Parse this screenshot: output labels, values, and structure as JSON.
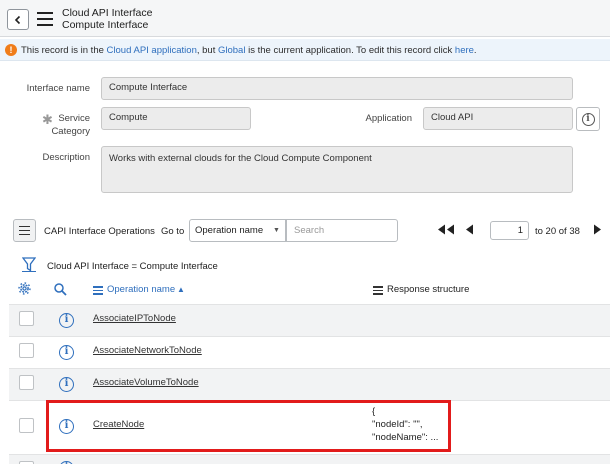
{
  "header": {
    "title_line1": "Cloud API Interface",
    "title_line2": "Compute Interface"
  },
  "banner": {
    "icon": "!",
    "text_1": "This record is in the ",
    "link_app": "Cloud API application",
    "text_2": ", but ",
    "link_global": "Global",
    "text_3": " is the current application. To edit this record click ",
    "link_here": "here",
    "text_4": "."
  },
  "form": {
    "interface_name_label": "Interface name",
    "interface_name_value": "Compute Interface",
    "required_mark": "✱",
    "service_category_label_1": "Service",
    "service_category_label_2": "Category",
    "service_category_value": "Compute",
    "application_label": "Application",
    "application_value": "Cloud API",
    "description_label": "Description",
    "description_value": "Works with external clouds for the Cloud Compute Component"
  },
  "list": {
    "title": "CAPI Interface Operations",
    "goto_label": "Go to",
    "goto_field": "Operation name",
    "search_placeholder": "Search",
    "page_value": "1",
    "page_range": "to 20 of 38",
    "filter_text": "Cloud API Interface = Compute Interface",
    "columns": {
      "operation_name": "Operation name",
      "response_structure": "Response structure",
      "sort_indicator": "▲"
    },
    "rows": [
      {
        "name": "AssociateIPToNode",
        "response": ""
      },
      {
        "name": "AssociateNetworkToNode",
        "response": ""
      },
      {
        "name": "AssociateVolumeToNode",
        "response": ""
      },
      {
        "name": "CreateNode",
        "response": "{\n\"nodeId\": \"\",\n\"nodeName\": ..."
      }
    ]
  },
  "colors": {
    "link": "#2f6fbd",
    "warning": "#f07d1a",
    "highlight": "#e21b1b"
  },
  "icons": [
    "back-icon",
    "menu-icon",
    "warning-icon",
    "info-icon",
    "list-menu-icon",
    "first-page-icon",
    "prev-page-icon",
    "next-page-icon",
    "filter-icon",
    "gear-icon",
    "search-icon"
  ]
}
